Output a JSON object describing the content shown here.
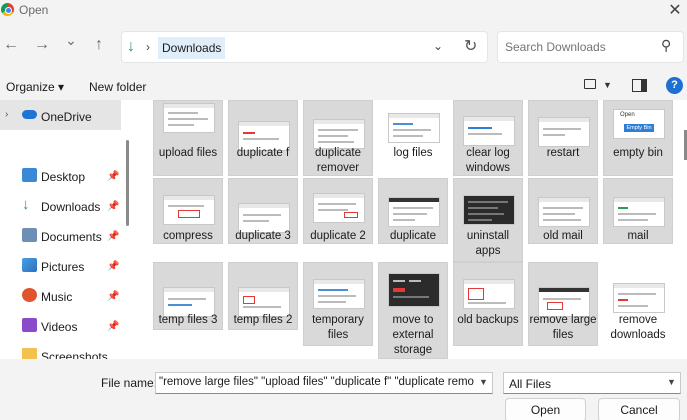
{
  "window": {
    "title": "Open",
    "close_glyph": "✕"
  },
  "nav": {
    "back_glyph": "←",
    "forward_glyph": "→",
    "recent_glyph": "⌄",
    "up_glyph": "↑",
    "breadcrumb_sep": "›",
    "current_folder": "Downloads",
    "address_dropdown_glyph": "⌄",
    "refresh_glyph": "↻",
    "search_placeholder": "Search Downloads",
    "search_icon": "search-icon"
  },
  "toolbar": {
    "organize_label": "Organize ▾",
    "new_folder_label": "New folder",
    "help_glyph": "?"
  },
  "sidebar": {
    "onedrive_label": "OneDrive",
    "items": [
      {
        "label": "Desktop",
        "icon": "desktop-icon",
        "pinned": true
      },
      {
        "label": "Downloads",
        "icon": "downloads-icon",
        "pinned": true
      },
      {
        "label": "Documents",
        "icon": "documents-icon",
        "pinned": true
      },
      {
        "label": "Pictures",
        "icon": "pictures-icon",
        "pinned": true
      },
      {
        "label": "Music",
        "icon": "music-icon",
        "pinned": true
      },
      {
        "label": "Videos",
        "icon": "videos-icon",
        "pinned": true
      },
      {
        "label": "Screenshots",
        "icon": "folder-icon",
        "pinned": false
      }
    ]
  },
  "files": [
    {
      "name": "upload files",
      "selected": true
    },
    {
      "name": "duplicate f",
      "selected": true
    },
    {
      "name": "duplicate remover",
      "selected": true
    },
    {
      "name": "log files",
      "selected": true
    },
    {
      "name": "clear log windows",
      "selected": true
    },
    {
      "name": "restart",
      "selected": true
    },
    {
      "name": "empty bin",
      "selected": true,
      "thumb_text": "Open",
      "thumb_button": "Empty Bin"
    },
    {
      "name": "compress",
      "selected": true
    },
    {
      "name": "duplicate 3",
      "selected": true
    },
    {
      "name": "duplicate 2",
      "selected": true
    },
    {
      "name": "duplicate",
      "selected": true
    },
    {
      "name": "uninstall apps",
      "selected": true
    },
    {
      "name": "old mail",
      "selected": true
    },
    {
      "name": "mail",
      "selected": true
    },
    {
      "name": "temp files 3",
      "selected": true
    },
    {
      "name": "temp files 2",
      "selected": true
    },
    {
      "name": "temporary files",
      "selected": true
    },
    {
      "name": "move to external storage",
      "selected": true
    },
    {
      "name": "old backups",
      "selected": true
    },
    {
      "name": "remove large files",
      "selected": true
    },
    {
      "name": "remove downloads",
      "selected": false
    }
  ],
  "footer": {
    "file_name_label": "File name:",
    "file_name_value": "\"remove large files\" \"upload files\" \"duplicate f\" \"duplicate remo",
    "file_type_value": "All Files",
    "open_label": "Open",
    "cancel_label": "Cancel"
  }
}
